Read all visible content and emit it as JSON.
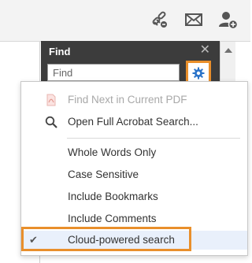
{
  "find_panel": {
    "title": "Find",
    "close_glyph": "✕",
    "search_placeholder": "Find",
    "gear_icon": "gear-icon"
  },
  "menu": {
    "items": [
      {
        "label": "Find Next in Current PDF",
        "enabled": false,
        "icon": "pdf-doc-icon"
      },
      {
        "label": "Open Full Acrobat Search...",
        "enabled": true,
        "icon": "search-icon"
      },
      {
        "label": "Whole Words Only",
        "enabled": true,
        "checked": false
      },
      {
        "label": "Case Sensitive",
        "enabled": true,
        "checked": false
      },
      {
        "label": "Include Bookmarks",
        "enabled": true,
        "checked": false
      },
      {
        "label": "Include Comments",
        "enabled": true,
        "checked": false
      },
      {
        "label": "Cloud-powered search",
        "enabled": true,
        "checked": true
      }
    ],
    "check_glyph": "✔"
  },
  "toolbar": {
    "icons": [
      "share-link-icon",
      "email-icon",
      "add-user-icon"
    ]
  },
  "colors": {
    "highlight": "#e98f2b",
    "panel_dark": "#3c3c3c",
    "gear_blue": "#2a73c9",
    "selected_row": "#e9f0fb"
  }
}
